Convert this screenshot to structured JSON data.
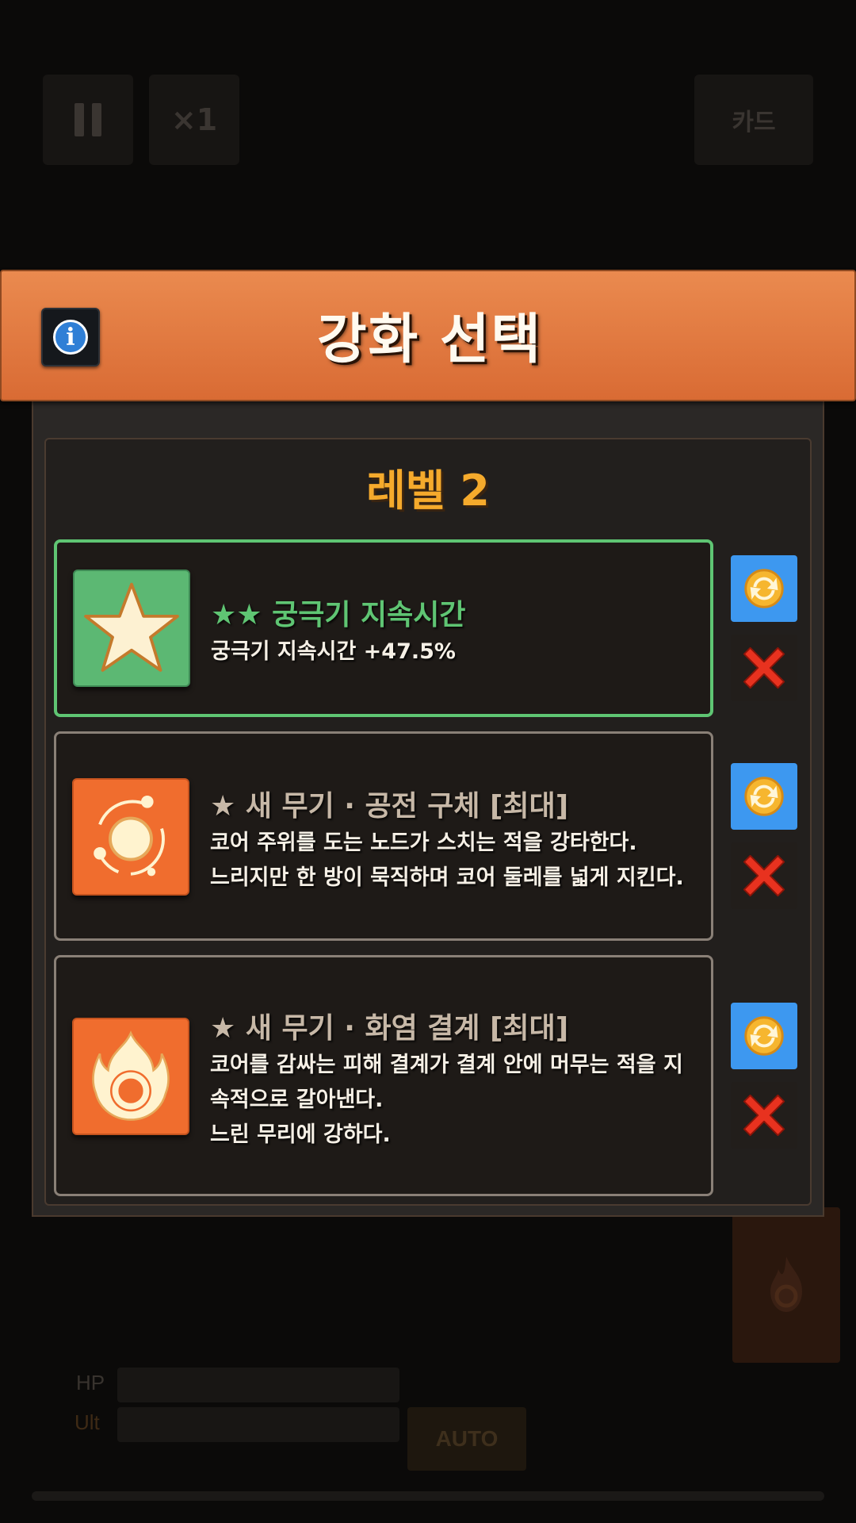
{
  "hud": {
    "speed_label": "×1",
    "cards_label": "카드",
    "hp_label": "HP",
    "ult_label": "Ult",
    "auto_label": "AUTO"
  },
  "modal": {
    "title": "강화 선택",
    "level": "레벨 2",
    "options": [
      {
        "stars": "★★",
        "title": "궁극기 지속시간",
        "desc": "궁극기 지속시간 +47.5%",
        "icon": "star-icon",
        "color": "#5fc573"
      },
      {
        "stars": "★",
        "title": "새 무기 · 공전 구체  [최대]",
        "desc": "코어 주위를 도는 노드가 스치는 적을 강타한다.\n느리지만 한 방이 묵직하며 코어 둘레를 넓게 지킨다.",
        "icon": "orbit-icon",
        "color": "#c7b8a7"
      },
      {
        "stars": "★",
        "title": "새 무기 · 화염 결계  [최대]",
        "desc": "코어를 감싸는 피해 결계가 결계 안에 머무는 적을 지\n속적으로 갈아낸다.\n느린 무리에 강하다.",
        "icon": "flame-ring-icon",
        "color": "#c7b8a7"
      }
    ]
  },
  "colors": {
    "header": "#e07a40",
    "accent_green": "#5fc573",
    "level_gold": "#f5aa2c",
    "reroll_blue": "#3d98f0",
    "discard_red": "#e8321f"
  }
}
